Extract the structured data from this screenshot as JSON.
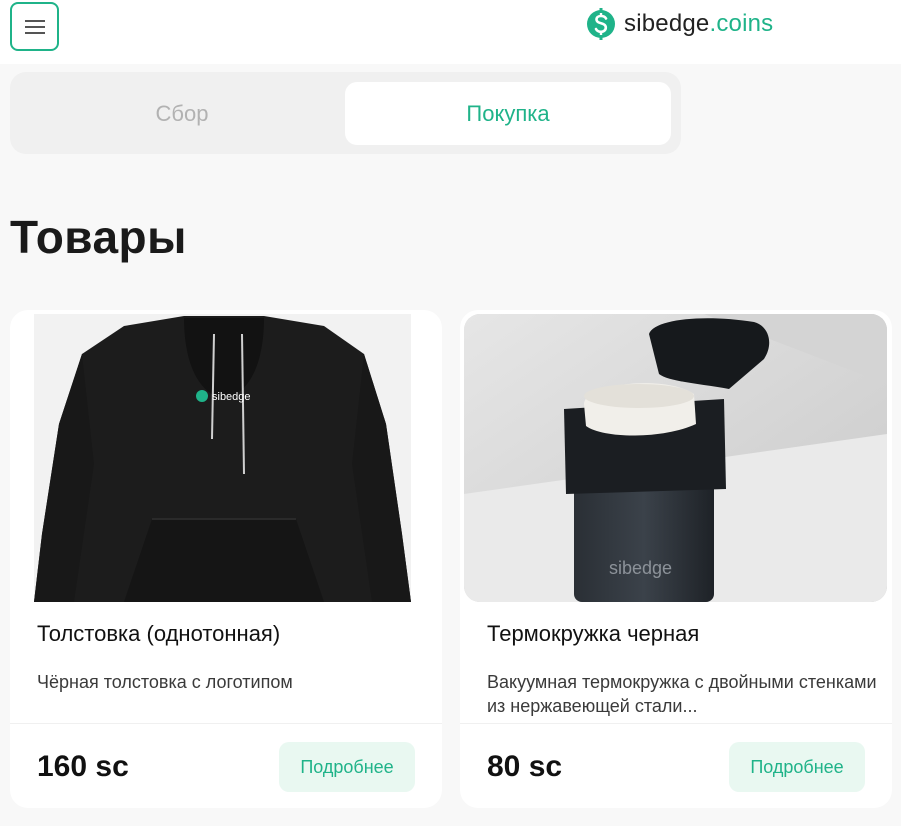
{
  "header": {
    "logo_text_main": "sibedge",
    "logo_text_accent": ".coins",
    "menu_icon": "hamburger-icon",
    "logo_icon": "dollar-icon"
  },
  "tabs": [
    {
      "label": "Сбор",
      "active": false
    },
    {
      "label": "Покупка",
      "active": true
    }
  ],
  "page": {
    "title": "Товары"
  },
  "products": [
    {
      "title": "Толстовка (однотонная)",
      "description": "Чёрная толстовка с логотипом",
      "price": "160 sc",
      "button_label": "Подробнее",
      "print_text": "sibedge"
    },
    {
      "title": "Термокружка черная",
      "description": "Вакуумная термокружка с двойными стенками из нержавеющей стали...",
      "price": "80 sc",
      "button_label": "Подробнее",
      "print_text": "sibedge"
    }
  ],
  "colors": {
    "accent": "#1fb389",
    "accent_light": "#e9f8f1",
    "background": "#f8f8f8",
    "inactive_tab_text": "#b2b2b2"
  }
}
